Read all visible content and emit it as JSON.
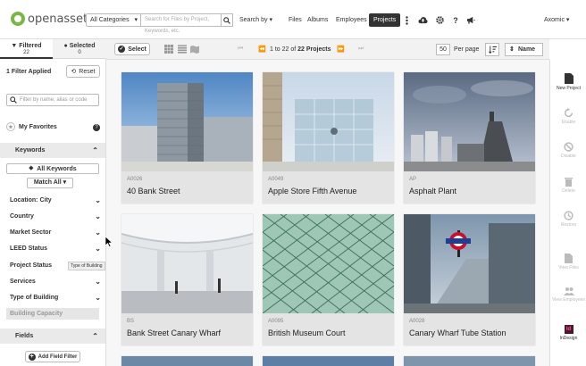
{
  "brand": {
    "name": "openasset",
    "accent": "#7ab648"
  },
  "header": {
    "category_select": "All Categories",
    "search_placeholder": "Search for Files by Project, Keywords, etc.",
    "sort_by": "Search by",
    "nav": [
      "Files",
      "Albums",
      "Employees",
      "Projects"
    ],
    "active_nav": "Projects",
    "user": "Axomic"
  },
  "sidebar": {
    "tabs": [
      {
        "label": "Filtered",
        "count": "22"
      },
      {
        "label": "Selected",
        "count": "0"
      }
    ],
    "filters_applied": "1 Filter Applied",
    "reset_label": "Reset",
    "filter_placeholder": "Filter by name, alias or code",
    "favorites_label": "My Favorites",
    "favorites_help": "?",
    "keywords_section": "Keywords",
    "all_keywords_label": "All Keywords",
    "match_label": "Match All",
    "filters": [
      "Location: City",
      "Country",
      "Market Sector",
      "LEED Status",
      "Project Status",
      "Services",
      "Type of Building"
    ],
    "tooltip": "Type of Building",
    "building_capacity": "Building Capacity",
    "fields_section": "Fields",
    "add_field_filter_label": "Add Field Filter"
  },
  "toolbar": {
    "select_label": "Select",
    "pager_prefix": "1 to 22 of",
    "pager_total": "22 Projects",
    "per_page": "50",
    "per_page_label": "Per page",
    "sort_label": "Name"
  },
  "projects": [
    {
      "code": "A0026",
      "name": "40 Bank Street"
    },
    {
      "code": "A0049",
      "name": "Apple Store Fifth Avenue"
    },
    {
      "code": "AP",
      "name": "Asphalt Plant"
    },
    {
      "code": "BS",
      "name": "Bank Street Canary Wharf"
    },
    {
      "code": "A0095",
      "name": "British Museum Court"
    },
    {
      "code": "A0028",
      "name": "Canary Wharf Tube Station"
    }
  ],
  "right_tools": [
    "New Project",
    "Enable",
    "Disable",
    "Delete",
    "Restore",
    "View Files",
    "View Employees",
    "InDesign"
  ]
}
